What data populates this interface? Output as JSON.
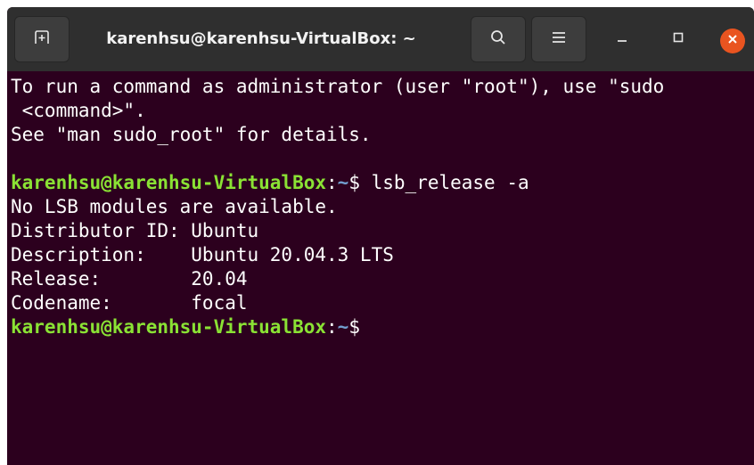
{
  "window": {
    "title": "karenhsu@karenhsu-VirtualBox: ~",
    "icons": {
      "new_tab": "new-tab-icon",
      "search": "search-icon",
      "menu": "hamburger-menu-icon",
      "minimize": "minimize-icon",
      "maximize": "maximize-icon",
      "close": "close-icon"
    }
  },
  "colors": {
    "terminal_bg": "#2c001e",
    "titlebar_bg": "#2f2f2f",
    "prompt_user": "#8ae234",
    "prompt_path": "#729fcf",
    "close_button": "#e95420"
  },
  "terminal": {
    "line1": "To run a command as administrator (user \"root\"), use \"sudo",
    "line2": " <command>\".",
    "line3": "See \"man sudo_root\" for details.",
    "prompt1": {
      "user_host": "karenhsu@karenhsu-VirtualBox",
      "colon": ":",
      "path": "~",
      "dollar": "$",
      "command": " lsb_release -a"
    },
    "line4": "No LSB modules are available.",
    "line5": "Distributor ID: Ubuntu",
    "line6": "Description:    Ubuntu 20.04.3 LTS",
    "line7": "Release:        20.04",
    "line8": "Codename:       focal",
    "prompt2": {
      "user_host": "karenhsu@karenhsu-VirtualBox",
      "colon": ":",
      "path": "~",
      "dollar": "$"
    }
  }
}
